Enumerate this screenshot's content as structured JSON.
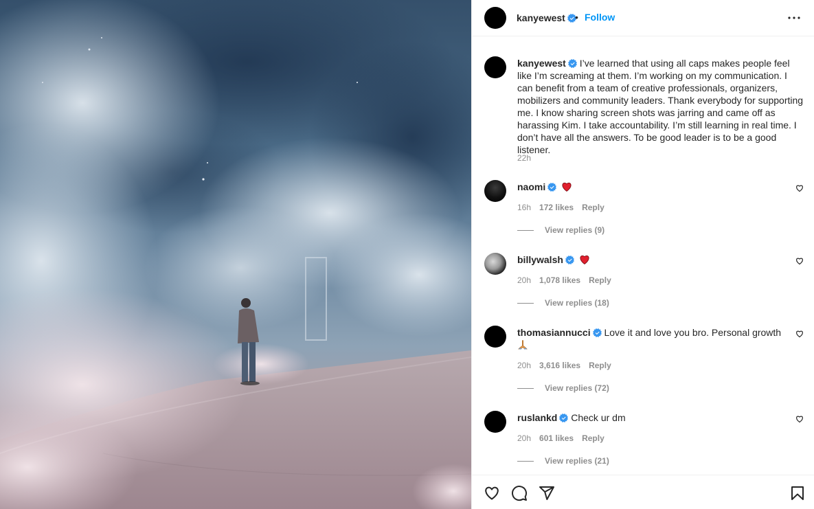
{
  "post": {
    "image_alt": "Performer standing alone on a stage surrounded by smoke clouds",
    "author": "kanyewest",
    "follow_label": "Follow",
    "separator": "•",
    "caption": "I’ve learned that using all caps makes people feel like I’m screaming at them. I’m working on my communication. I can benefit from a team of creative professionals, organizers, mobilizers and community leaders. Thank everybody for supporting me. I know sharing screen shots was jarring and came off as harassing Kim. I take accountability. I’m still learning in real time. I don’t have all the answers. To be good leader is to be a good listener.",
    "time": "22h"
  },
  "comments": [
    {
      "user": "naomi",
      "text": "",
      "emoji": "heart",
      "time": "16h",
      "likes": "172 likes",
      "reply_label": "Reply",
      "replies": "View replies (9)"
    },
    {
      "user": "billywalsh",
      "text": "",
      "emoji": "heart",
      "time": "20h",
      "likes": "1,078 likes",
      "reply_label": "Reply",
      "replies": "View replies (18)"
    },
    {
      "user": "thomasiannucci",
      "text": "Love it and love you bro. Personal growth",
      "emoji": "pray",
      "time": "20h",
      "likes": "3,616 likes",
      "reply_label": "Reply",
      "replies": "View replies (72)"
    },
    {
      "user": "ruslankd",
      "text": "Check ur dm",
      "emoji": "",
      "time": "20h",
      "likes": "601 likes",
      "reply_label": "Reply",
      "replies": "View replies (21)"
    }
  ],
  "icons": {
    "verified": "verified-badge-icon",
    "more": "more-options-icon",
    "like": "heart-outline-icon",
    "comment": "comment-bubble-icon",
    "share": "paper-plane-icon",
    "save": "bookmark-icon"
  },
  "colors": {
    "accent": "#0095f6",
    "verified": "#3897f0",
    "heart": "#ed4956",
    "muted": "#8e8e8e",
    "text": "#262626"
  }
}
